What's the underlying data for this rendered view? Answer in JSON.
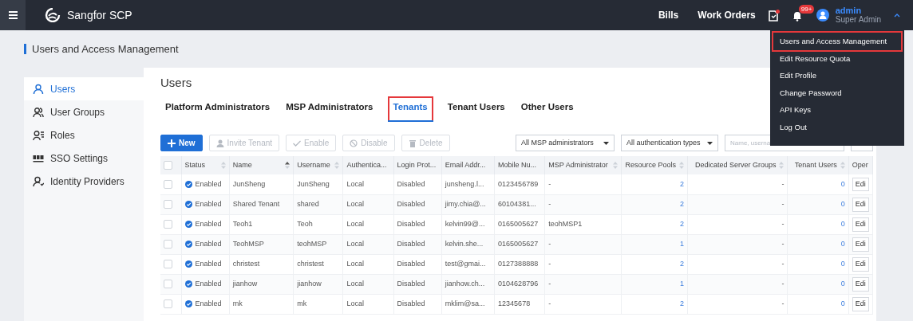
{
  "navbar": {
    "brand": "Sangfor SCP",
    "links": [
      "Bills",
      "Work Orders"
    ],
    "doc_alert": true,
    "notification_badge": "99+",
    "user": {
      "name": "admin",
      "role": "Super Admin"
    }
  },
  "user_menu": {
    "items": [
      {
        "label": "Users and Access Management",
        "highlighted": true
      },
      {
        "label": "Edit Resource Quota",
        "highlighted": false
      },
      {
        "label": "Edit Profile",
        "highlighted": false
      },
      {
        "label": "Change Password",
        "highlighted": false
      },
      {
        "label": "API Keys",
        "highlighted": false
      },
      {
        "label": "Log Out",
        "highlighted": false
      }
    ]
  },
  "page_header": {
    "title": "Users and Access Management"
  },
  "sidebar": {
    "items": [
      {
        "label": "Users",
        "kind": "user",
        "selected": true
      },
      {
        "label": "User Groups",
        "kind": "group",
        "selected": false
      },
      {
        "label": "Roles",
        "kind": "role",
        "selected": false
      },
      {
        "label": "SSO Settings",
        "kind": "sso",
        "selected": false
      },
      {
        "label": "Identity Providers",
        "kind": "idp",
        "selected": false
      }
    ]
  },
  "content": {
    "title": "Users",
    "tabs": [
      {
        "label": "Platform Administrators",
        "selected": false,
        "highlighted": false
      },
      {
        "label": "MSP Administrators",
        "selected": false,
        "highlighted": false
      },
      {
        "label": "Tenants",
        "selected": true,
        "highlighted": true
      },
      {
        "label": "Tenant Users",
        "selected": false,
        "highlighted": false
      },
      {
        "label": "Other Users",
        "selected": false,
        "highlighted": false
      }
    ],
    "toolbar": [
      {
        "label": "New",
        "kind": "new",
        "disabled": false
      },
      {
        "label": "Invite Tenant",
        "kind": "invite",
        "disabled": true
      },
      {
        "label": "Enable",
        "kind": "enable",
        "disabled": true
      },
      {
        "label": "Disable",
        "kind": "disable",
        "disabled": true
      },
      {
        "label": "Delete",
        "kind": "delete",
        "disabled": true
      }
    ],
    "filters": [
      {
        "value": "All MSP administrators"
      },
      {
        "value": "All authentication types"
      }
    ],
    "search": {
      "placeholder": "Name, userna"
    },
    "table": {
      "select_all": {
        "checked": false
      },
      "columns": [
        {
          "label": "Status",
          "kind": "status",
          "sorted": false
        },
        {
          "label": "Name",
          "kind": "text",
          "sorted": true
        },
        {
          "label": "Username",
          "kind": "text",
          "sorted": false
        },
        {
          "label": "Authentica...",
          "kind": "text"
        },
        {
          "label": "Login Prot...",
          "kind": "text"
        },
        {
          "label": "Email Addr...",
          "kind": "text"
        },
        {
          "label": "Mobile Nu...",
          "kind": "text"
        },
        {
          "label": "MSP Administrator",
          "kind": "text",
          "sorted": false
        },
        {
          "label": "Resource Pools",
          "kind": "link",
          "sorted": false
        },
        {
          "label": "Dedicated Server Groups",
          "kind": "number",
          "sorted": false
        },
        {
          "label": "Tenant Users",
          "kind": "link",
          "sorted": false
        },
        {
          "label": "Oper",
          "kind": "action"
        }
      ],
      "rows": [
        {
          "checked": false,
          "cells": [
            "Enabled",
            "JunSheng",
            "JunSheng",
            "Local",
            "Disabled",
            "junsheng.l...",
            "0123456789",
            "-",
            "2",
            "-",
            "0",
            "Edi"
          ]
        },
        {
          "checked": false,
          "cells": [
            "Enabled",
            "Shared Tenant",
            "shared",
            "Local",
            "Disabled",
            "jimy.chia@...",
            "60104381...",
            "-",
            "2",
            "-",
            "0",
            "Edi"
          ]
        },
        {
          "checked": false,
          "cells": [
            "Enabled",
            "Teoh1",
            "Teoh",
            "Local",
            "Disabled",
            "kelvin99@...",
            "0165005627",
            "teohMSP1",
            "2",
            "-",
            "0",
            "Edi"
          ]
        },
        {
          "checked": false,
          "cells": [
            "Enabled",
            "TeohMSP",
            "teohMSP",
            "Local",
            "Disabled",
            "kelvin.she...",
            "0165005627",
            "-",
            "1",
            "-",
            "0",
            "Edi"
          ]
        },
        {
          "checked": false,
          "cells": [
            "Enabled",
            "christest",
            "christest",
            "Local",
            "Disabled",
            "test@gmai...",
            "0127388888",
            "-",
            "2",
            "-",
            "0",
            "Edi"
          ]
        },
        {
          "checked": false,
          "cells": [
            "Enabled",
            "jianhow",
            "jianhow",
            "Local",
            "Disabled",
            "jianhow.ch...",
            "0104628796",
            "-",
            "1",
            "-",
            "0",
            "Edi"
          ]
        },
        {
          "checked": false,
          "cells": [
            "Enabled",
            "mk",
            "mk",
            "Local",
            "Disabled",
            "mklim@sa...",
            "12345678",
            "-",
            "2",
            "-",
            "0",
            "Edi"
          ]
        }
      ]
    }
  }
}
